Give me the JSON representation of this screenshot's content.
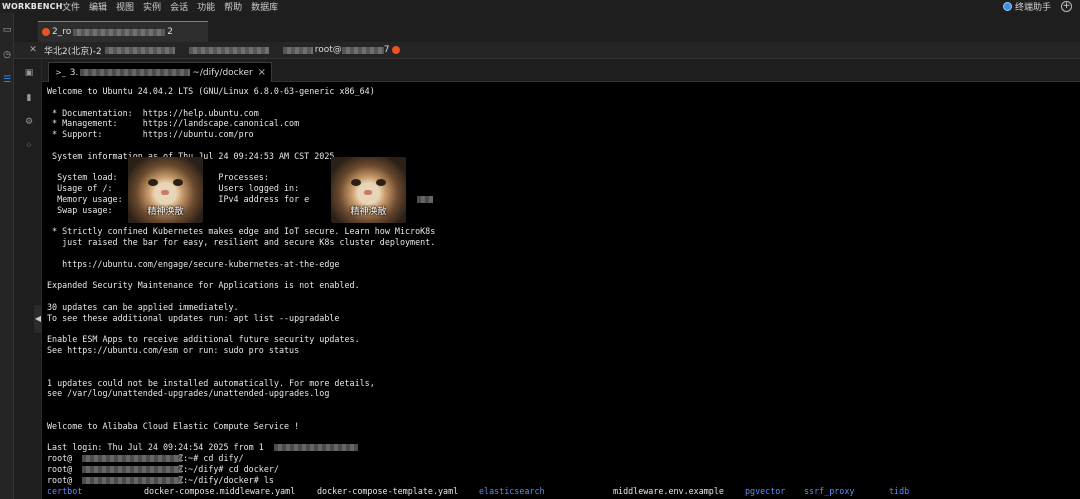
{
  "app": {
    "brand": "WORKBENCH",
    "menu": [
      "文件",
      "编辑",
      "视图",
      "实例",
      "会话",
      "功能",
      "帮助",
      "数据库"
    ],
    "assistant_label": "终端助手"
  },
  "session_tab": {
    "prefix": "2_ro",
    "suffix": "2"
  },
  "infobar": {
    "region_prefix": "华北2(北京)-2",
    "user_fragment": "root@",
    "suffix": "7"
  },
  "terminal_tab": {
    "prefix": "3.",
    "path": "~/dify/docker"
  },
  "terminal": {
    "lines": [
      "Welcome to Ubuntu 24.04.2 LTS (GNU/Linux 6.8.0-63-generic x86_64)",
      "",
      " * Documentation:  https://help.ubuntu.com",
      " * Management:     https://landscape.canonical.com",
      " * Support:        https://ubuntu.com/pro",
      "",
      " System information as of Thu Jul 24 09:24:53 AM CST 2025",
      "",
      "  System load:                    Processes:",
      "  Usage of /:              01GB   Users logged in:",
      "  Memory usage:                   IPv4 address for e",
      "  Swap usage:",
      "",
      " * Strictly confined Kubernetes makes edge and IoT secure. Learn how MicroK8s",
      "   just raised the bar for easy, resilient and secure K8s cluster deployment.",
      "",
      "   https://ubuntu.com/engage/secure-kubernetes-at-the-edge",
      "",
      "Expanded Security Maintenance for Applications is not enabled.",
      "",
      "30 updates can be applied immediately.",
      "To see these additional updates run: apt list --upgradable",
      "",
      "Enable ESM Apps to receive additional future security updates.",
      "See https://ubuntu.com/esm or run: sudo pro status",
      "",
      "",
      "1 updates could not be installed automatically. For more details,",
      "see /var/log/unattended-upgrades/unattended-upgrades.log",
      "",
      "",
      "Welcome to Alibaba Cloud Elastic Compute Service !",
      "",
      "Last login: Thu Jul 24 09:24:54 2025 from 1",
      "root@                     Z:~# cd dify/",
      "root@                     Z:~/dify# cd docker/",
      "root@                     Z:~/dify/docker# ls"
    ],
    "ls_output": [
      {
        "name": "certbot",
        "kind": "dir"
      },
      {
        "name": "docker-compose.middleware.yaml",
        "kind": "file"
      },
      {
        "name": "docker-compose-template.yaml",
        "kind": "file"
      },
      {
        "name": "elasticsearch",
        "kind": "dir"
      },
      {
        "name": "middleware.env.example",
        "kind": "file"
      },
      {
        "name": "pgvector",
        "kind": "dir"
      },
      {
        "name": "ssrf_proxy",
        "kind": "dir"
      },
      {
        "name": "tidb",
        "kind": "dir"
      }
    ]
  },
  "stickers": [
    {
      "caption": "精神涣散"
    },
    {
      "caption": "精神涣散"
    }
  ],
  "colors": {
    "accent": "#3b8eea",
    "directory": "#5b8cff",
    "ubuntu": "#e95420"
  }
}
